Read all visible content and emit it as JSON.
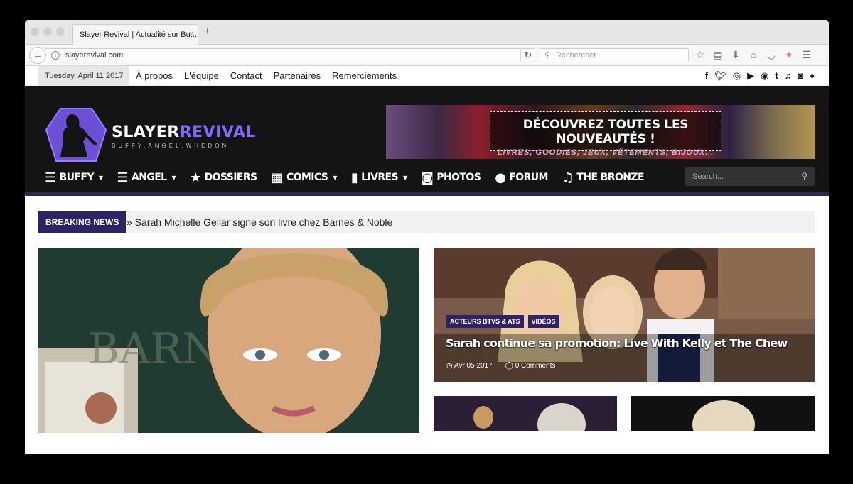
{
  "browser": {
    "tab_title": "Slayer Revival | Actualité sur Bu...",
    "tab_close": "×",
    "new_tab": "+",
    "url": "slayerevival.com",
    "search_placeholder": "Rechercher"
  },
  "topbar": {
    "date": "Tuesday, April 11 2017",
    "links": [
      "À propos",
      "L'équipe",
      "Contact",
      "Partenaires",
      "Remerciements"
    ],
    "social_icons": [
      "facebook-icon",
      "twitter-icon",
      "instagram-icon",
      "youtube-icon",
      "chat-icon",
      "tumblr-icon",
      "music-icon",
      "camera-icon",
      "microphone-icon"
    ]
  },
  "logo": {
    "title_part1": "SLAYER",
    "title_part2": "REVIVAL",
    "subtitle": "BUFFY.ANGEL.WHEDON"
  },
  "banner": {
    "line1": "DÉCOUVREZ TOUTES LES NOUVEAUTÉS !",
    "line2": "LIVRES, GOODIES, JEUX, VÊTEMENTS, BIJOUX..."
  },
  "mainnav": {
    "items": [
      {
        "label": "BUFFY",
        "icon": "☰",
        "caret": true
      },
      {
        "label": "ANGEL",
        "icon": "☰",
        "caret": true
      },
      {
        "label": "DOSSIERS",
        "icon": "★",
        "caret": false
      },
      {
        "label": "COMICS",
        "icon": "▦",
        "caret": true
      },
      {
        "label": "LIVRES",
        "icon": "▮",
        "caret": true
      },
      {
        "label": "PHOTOS",
        "icon": "◙",
        "caret": false
      },
      {
        "label": "FORUM",
        "icon": "●",
        "caret": false
      },
      {
        "label": "THE BRONZE",
        "icon": "♫",
        "caret": false
      }
    ],
    "search_placeholder": "Search..."
  },
  "breaking": {
    "label": "BREAKING NEWS",
    "text": "» Sarah Michelle Gellar signe son livre chez Barnes & Noble"
  },
  "featured_right": {
    "tags": [
      "ACTEURS BTVS & ATS",
      "VIDÉOS"
    ],
    "title": "Sarah continue sa promotion: Live With Kelly et The Chew",
    "date": "Avr 05 2017",
    "comments": "0 Comments"
  },
  "colors": {
    "accent": "#2d2466",
    "header_bg": "#141414",
    "logo_purple": "#8a67ff"
  }
}
